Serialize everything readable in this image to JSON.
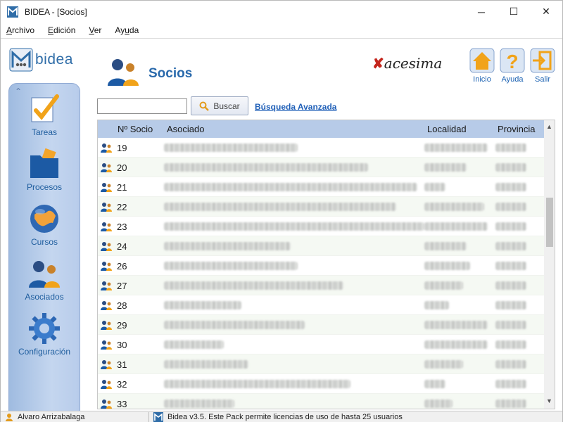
{
  "window": {
    "title": "BIDEA - [Socios]",
    "controls": {
      "minimize": "─",
      "maximize": "☐",
      "close": "✕"
    }
  },
  "menubar": [
    {
      "pre": "",
      "u": "A",
      "post": "rchivo"
    },
    {
      "pre": "",
      "u": "E",
      "post": "dición"
    },
    {
      "pre": "",
      "u": "V",
      "post": "er"
    },
    {
      "pre": "Ay",
      "u": "u",
      "post": "da"
    }
  ],
  "brand": {
    "name": "bidea"
  },
  "nav": [
    {
      "label": "Tareas",
      "icon": "checkmark-icon"
    },
    {
      "label": "Procesos",
      "icon": "folder-icon"
    },
    {
      "label": "Cursos",
      "icon": "globe-icon"
    },
    {
      "label": "Asociados",
      "icon": "people-icon"
    },
    {
      "label": "Configuración",
      "icon": "gear-icon"
    }
  ],
  "header": {
    "title": "Socios",
    "partner": "acesima",
    "buttons": [
      {
        "label": "Inicio",
        "icon": "home-icon"
      },
      {
        "label": "Ayuda",
        "icon": "help-icon"
      },
      {
        "label": "Salir",
        "icon": "exit-icon"
      }
    ]
  },
  "search": {
    "value": "",
    "placeholder": "",
    "button_label": "Buscar",
    "advanced_link": "Búsqueda Avanzada"
  },
  "table": {
    "columns": [
      "Nº Socio",
      "Asociado",
      "Localidad",
      "Provincia"
    ],
    "rows": [
      {
        "num": "19"
      },
      {
        "num": "20"
      },
      {
        "num": "21"
      },
      {
        "num": "22"
      },
      {
        "num": "23"
      },
      {
        "num": "24"
      },
      {
        "num": "26"
      },
      {
        "num": "27"
      },
      {
        "num": "28"
      },
      {
        "num": "29"
      },
      {
        "num": "30"
      },
      {
        "num": "31"
      },
      {
        "num": "32"
      },
      {
        "num": "33"
      }
    ],
    "note": "Asociado, Localidad and Provincia cell values are blurred/redacted in the screenshot"
  },
  "statusbar": {
    "user": "Alvaro Arrizabalaga",
    "info": "Bidea v3.5. Este Pack permite licencias de uso de hasta 25 usuarios"
  },
  "colors": {
    "accent": "#2a6aac",
    "header_row": "#b7cbe8",
    "nav_panel": "#b8cceb",
    "link": "#2060b8"
  }
}
